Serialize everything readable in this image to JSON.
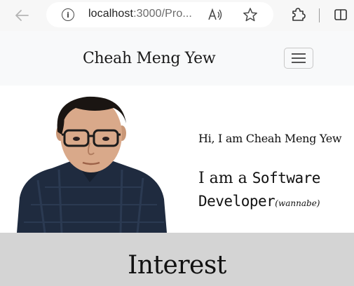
{
  "browser": {
    "url_host": "localhost",
    "url_rest": ":3000/Pro..."
  },
  "navbar": {
    "brand": "Cheah Meng Yew"
  },
  "hero": {
    "greeting": "Hi, I am Cheah Meng Yew",
    "role_prefix": "I am a ",
    "role_title": "Software Developer",
    "role_note": "(wannabe)"
  },
  "interest": {
    "title": "Interest"
  },
  "colors": {
    "navbar_bg": "#f8f9fa",
    "interest_bg": "#d4d4d4",
    "shirt": "#1f2b3f"
  }
}
